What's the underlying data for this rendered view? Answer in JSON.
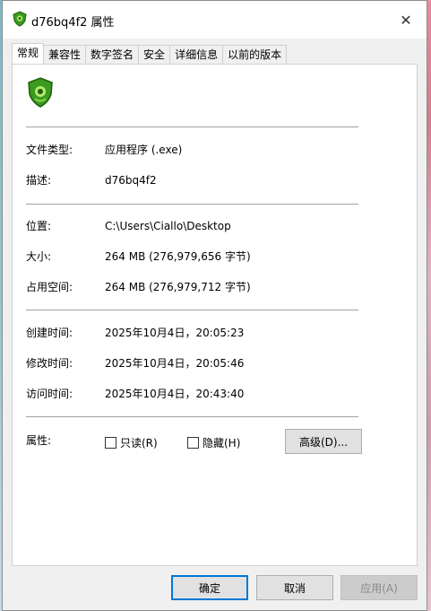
{
  "window": {
    "title": "d76bq4f2 属性",
    "close_glyph": "✕",
    "title_icon": "dr-web-shield-icon"
  },
  "tabs": [
    {
      "label": "常规",
      "active": true
    },
    {
      "label": "兼容性",
      "active": false
    },
    {
      "label": "数字签名",
      "active": false
    },
    {
      "label": "安全",
      "active": false
    },
    {
      "label": "详细信息",
      "active": false
    },
    {
      "label": "以前的版本",
      "active": false
    }
  ],
  "general": {
    "file_icon": "dr-web-shield-icon",
    "file_type_label": "文件类型:",
    "file_type_value": "应用程序 (.exe)",
    "description_label": "描述:",
    "description_value": "d76bq4f2",
    "location_label": "位置:",
    "location_value": "C:\\Users\\Ciallo\\Desktop",
    "size_label": "大小:",
    "size_value": "264 MB (276,979,656 字节)",
    "size_on_disk_label": "占用空间:",
    "size_on_disk_value": "264 MB (276,979,712 字节)",
    "created_label": "创建时间:",
    "created_value": "2025年10月4日，20:05:23",
    "modified_label": "修改时间:",
    "modified_value": "2025年10月4日，20:05:46",
    "accessed_label": "访问时间:",
    "accessed_value": "2025年10月4日，20:43:40",
    "attributes_label": "属性:",
    "readonly_label": "只读(R)",
    "readonly_checked": false,
    "hidden_label": "隐藏(H)",
    "hidden_checked": false,
    "advanced_label": "高级(D)..."
  },
  "buttons": {
    "ok": "确定",
    "cancel": "取消",
    "apply": "应用(A)"
  },
  "colors": {
    "accent": "#0078d7",
    "icon_green": "#3a9b1e"
  }
}
